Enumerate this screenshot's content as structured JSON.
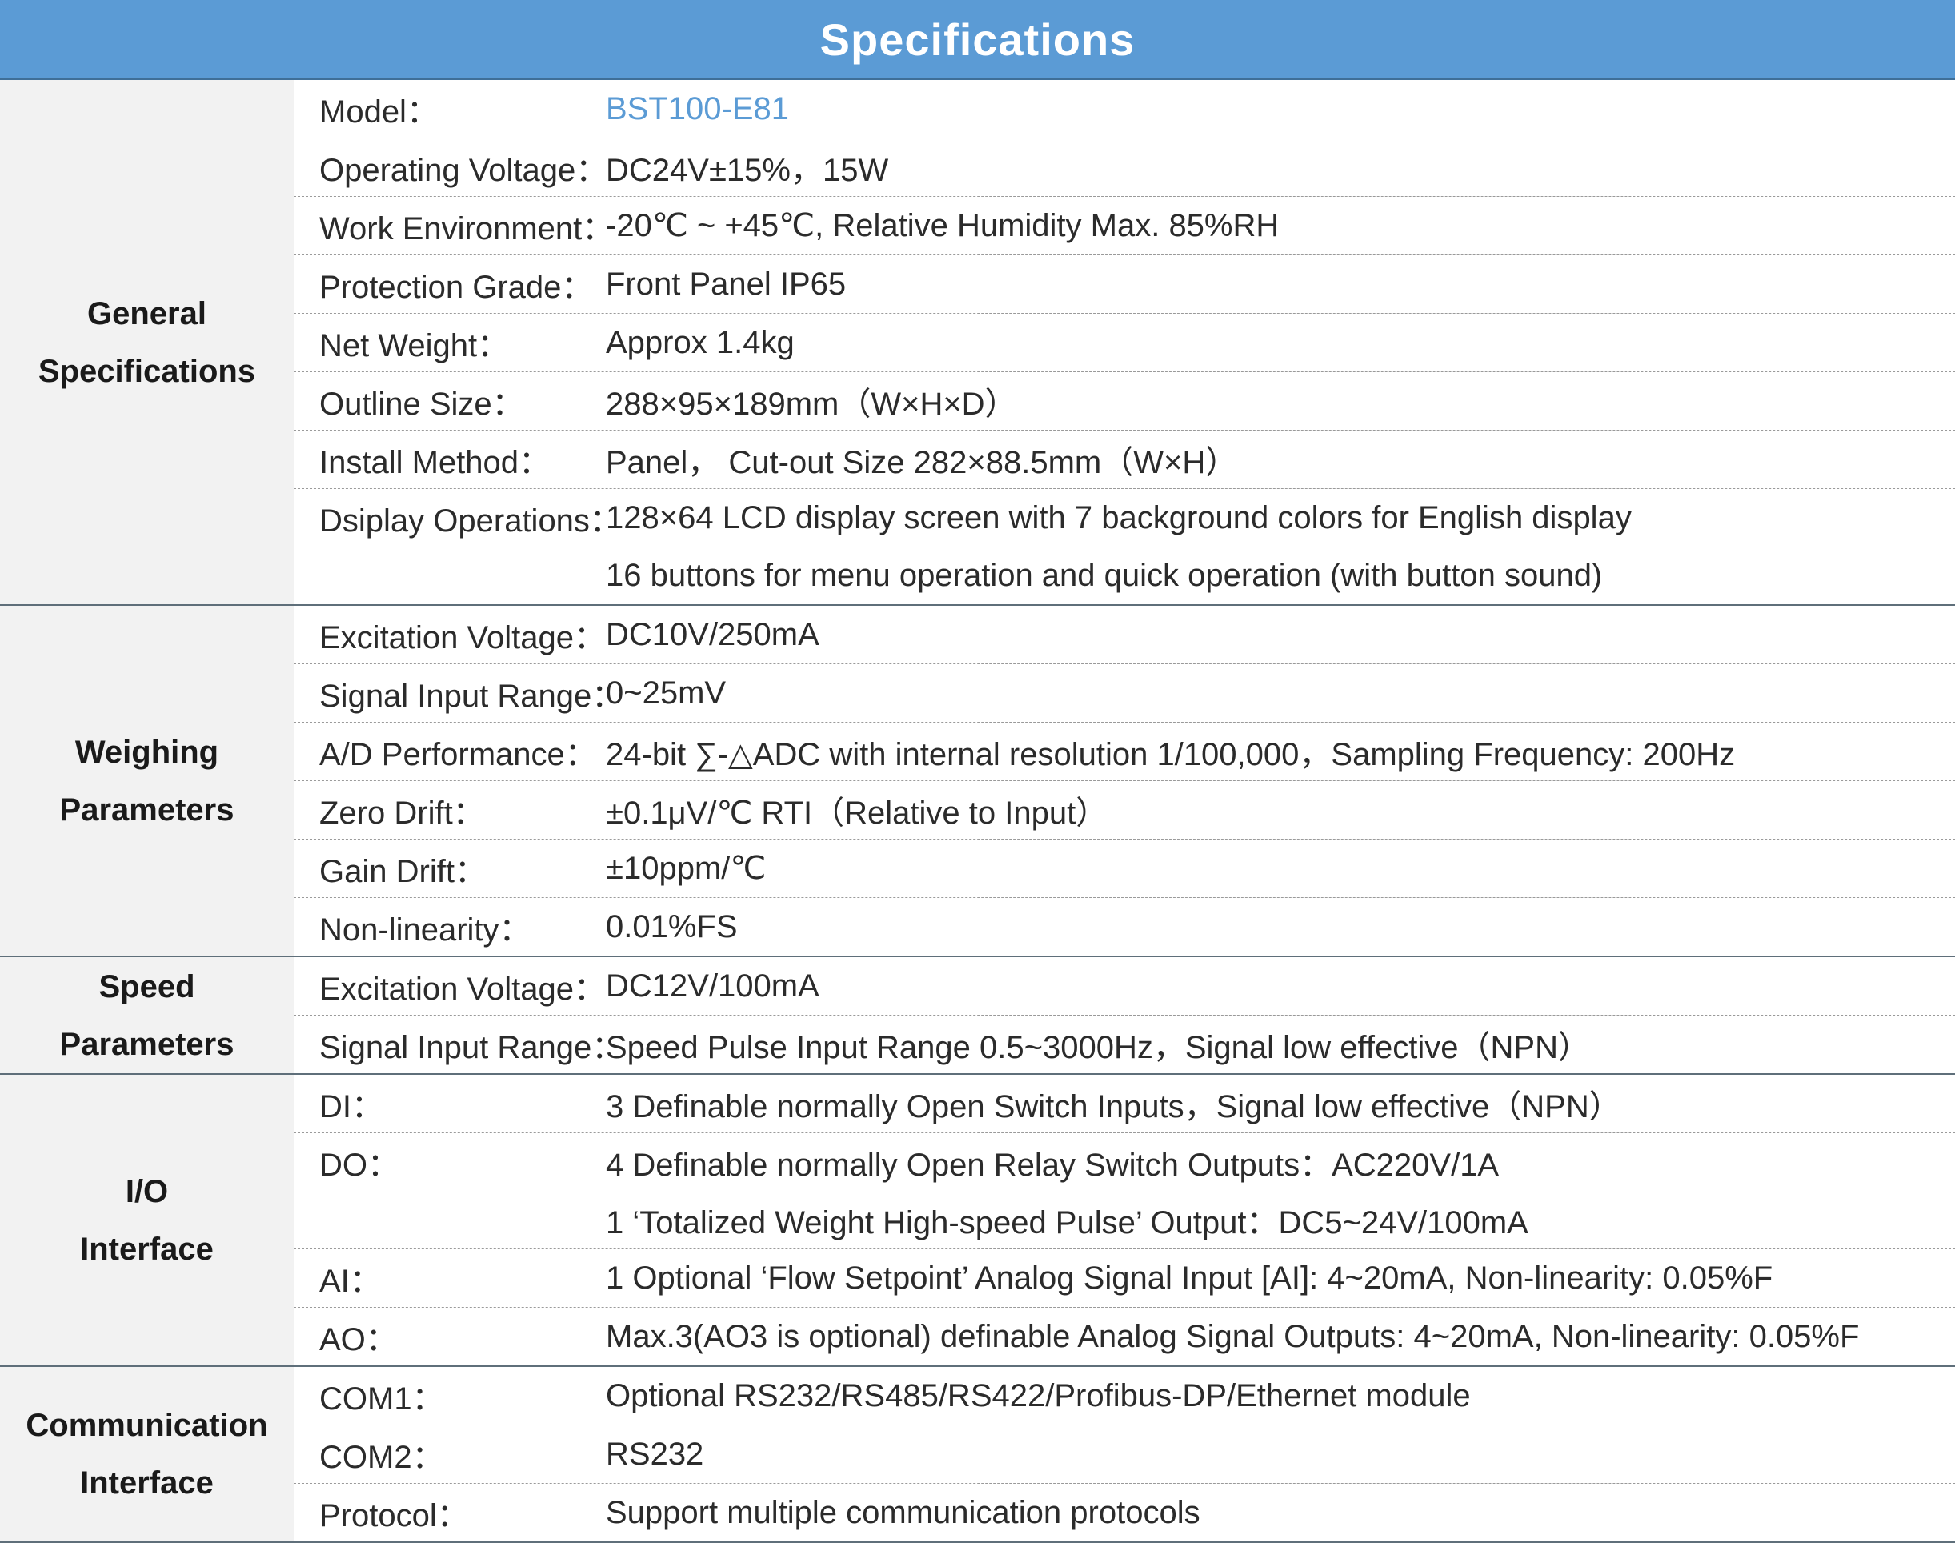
{
  "title": "Specifications",
  "accent_color": "#5b9bd5",
  "sections": [
    {
      "label": "General\nSpecifications",
      "rows": [
        {
          "key": "Model：",
          "values": [
            "BST100-E81"
          ],
          "accent": true
        },
        {
          "key": "Operating Voltage：",
          "values": [
            "DC24V±15%，15W"
          ]
        },
        {
          "key": "Work Environment：",
          "values": [
            "-20℃ ~ +45℃, Relative Humidity Max. 85%RH"
          ]
        },
        {
          "key": "Protection Grade：",
          "values": [
            "Front Panel  IP65"
          ]
        },
        {
          "key": "Net Weight：",
          "values": [
            "Approx  1.4kg"
          ]
        },
        {
          "key": "Outline Size：",
          "values": [
            "288×95×189mm（W×H×D）"
          ]
        },
        {
          "key": "Install Method：",
          "values": [
            "Panel，  Cut-out Size  282×88.5mm（W×H）"
          ]
        },
        {
          "key": "Dsiplay Operations：",
          "values": [
            "128×64 LCD display screen with 7 background colors for English display",
            "16 buttons for menu operation and quick operation (with button sound)"
          ]
        }
      ]
    },
    {
      "label": "Weighing\nParameters",
      "rows": [
        {
          "key": "Excitation Voltage：",
          "values": [
            "DC10V/250mA"
          ]
        },
        {
          "key": "Signal Input Range：",
          "values": [
            "0~25mV"
          ]
        },
        {
          "key": "A/D Performance：",
          "values": [
            "24-bit ∑-△ADC with internal resolution 1/100,000，Sampling Frequency: 200Hz"
          ]
        },
        {
          "key": "Zero Drift：",
          "values": [
            "±0.1μV/℃ RTI（Relative to Input）"
          ]
        },
        {
          "key": "Gain Drift：",
          "values": [
            "±10ppm/℃"
          ]
        },
        {
          "key": "Non-linearity：",
          "values": [
            "0.01%FS"
          ]
        }
      ]
    },
    {
      "label": "Speed\nParameters",
      "rows": [
        {
          "key": "Excitation Voltage：",
          "values": [
            "DC12V/100mA"
          ]
        },
        {
          "key": "Signal Input Range：",
          "values": [
            "Speed Pulse Input Range  0.5~3000Hz，Signal low effective（NPN）"
          ]
        }
      ]
    },
    {
      "label": "I/O\nInterface",
      "rows": [
        {
          "key": "DI：",
          "values": [
            "3 Definable normally Open Switch Inputs，Signal low effective（NPN）"
          ]
        },
        {
          "key": "DO：",
          "values": [
            "4 Definable normally Open Relay Switch Outputs：AC220V/1A",
            "1 ‘Totalized Weight High-speed Pulse’ Output：DC5~24V/100mA"
          ]
        },
        {
          "key": "AI：",
          "values": [
            "1 Optional ‘Flow Setpoint’ Analog Signal Input [AI]: 4~20mA, Non-linearity: 0.05%F"
          ]
        },
        {
          "key": "AO：",
          "values": [
            "Max.3(AO3 is optional) definable Analog Signal Outputs: 4~20mA, Non-linearity: 0.05%F"
          ]
        }
      ]
    },
    {
      "label": "Communication\nInterface",
      "rows": [
        {
          "key": "COM1：",
          "values": [
            "Optional RS232/RS485/RS422/Profibus-DP/Ethernet module"
          ]
        },
        {
          "key": "COM2：",
          "values": [
            "RS232"
          ]
        },
        {
          "key": "Protocol：",
          "values": [
            "Support multiple communication protocols"
          ]
        }
      ]
    }
  ]
}
